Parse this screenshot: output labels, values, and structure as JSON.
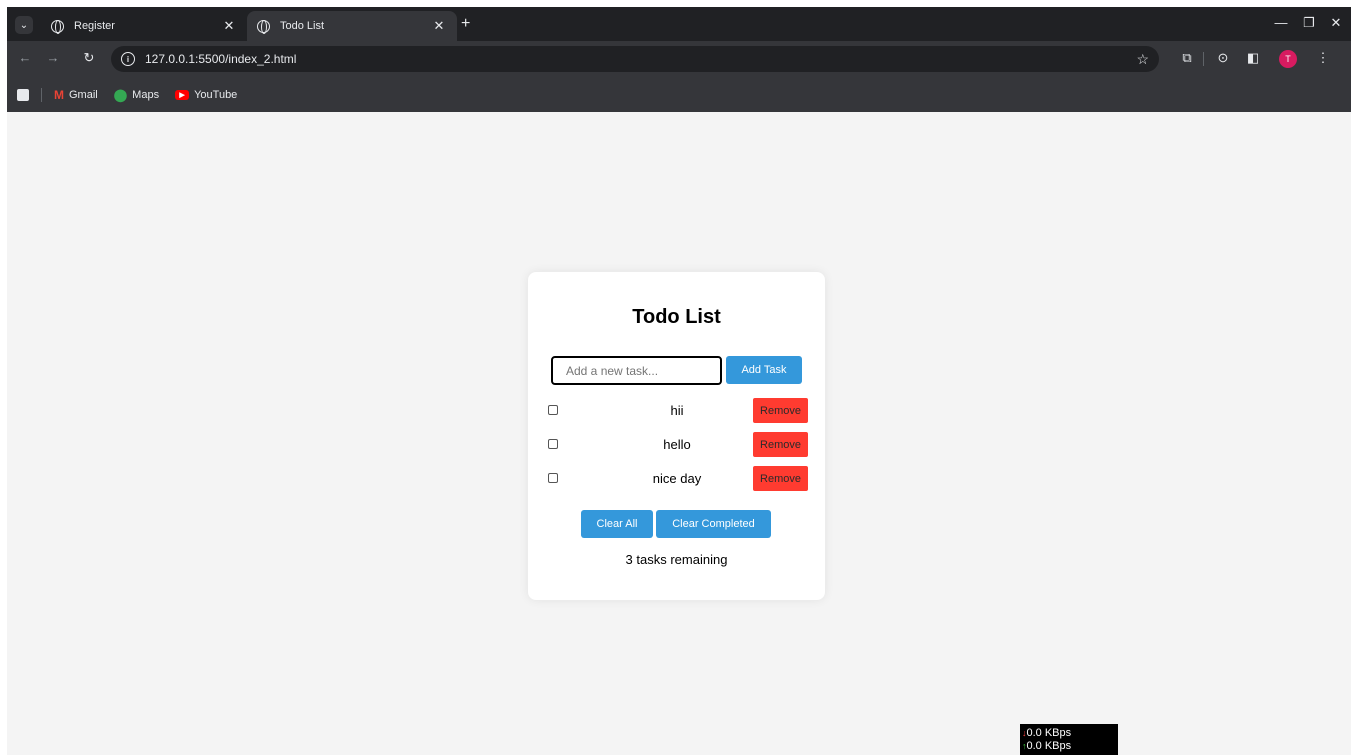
{
  "browser": {
    "tabs": [
      {
        "title": "Register",
        "active": false
      },
      {
        "title": "Todo List",
        "active": true
      }
    ],
    "url": "127.0.0.1:5500/index_2.html",
    "profile_initial": "T",
    "bookmarks": [
      {
        "label": "Gmail",
        "icon": "gmail-icon"
      },
      {
        "label": "Maps",
        "icon": "maps-icon"
      },
      {
        "label": "YouTube",
        "icon": "youtube-icon"
      }
    ]
  },
  "todo": {
    "title": "Todo List",
    "input_placeholder": "Add a new task...",
    "add_button": "Add Task",
    "tasks": [
      {
        "text": "hii",
        "completed": false,
        "remove_label": "Remove"
      },
      {
        "text": "hello",
        "completed": false,
        "remove_label": "Remove"
      },
      {
        "text": "nice day",
        "completed": false,
        "remove_label": "Remove"
      }
    ],
    "clear_all": "Clear All",
    "clear_completed": "Clear Completed",
    "remaining_text": "3 tasks remaining"
  },
  "network_widget": {
    "download": "0.0 KBps",
    "upload": "0.0 KBps"
  },
  "colors": {
    "primary_button": "#3498db",
    "remove_button": "#ff3b30",
    "page_background": "#f4f4f4"
  }
}
